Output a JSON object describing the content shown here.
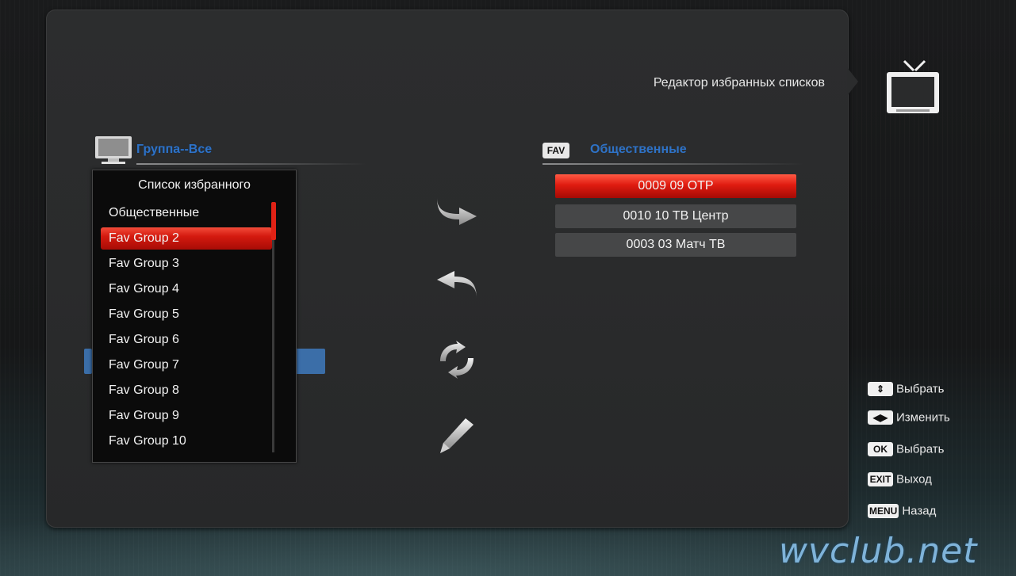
{
  "screen": {
    "title": "Редактор избранных списков"
  },
  "group": {
    "title": "Группа--Все"
  },
  "favorite_popup": {
    "header": "Список избранного",
    "items": [
      {
        "label": "Общественные"
      },
      {
        "label": "Fav Group 2",
        "selected": true
      },
      {
        "label": "Fav Group 3"
      },
      {
        "label": "Fav Group 4"
      },
      {
        "label": "Fav Group 5"
      },
      {
        "label": "Fav Group 6"
      },
      {
        "label": "Fav Group 7"
      },
      {
        "label": "Fav Group 8"
      },
      {
        "label": "Fav Group 9"
      },
      {
        "label": "Fav Group 10"
      }
    ]
  },
  "actions": [
    {
      "icon": "move-right-arrow-icon"
    },
    {
      "icon": "move-left-arrow-icon"
    },
    {
      "icon": "swap-circular-arrows-icon"
    },
    {
      "icon": "edit-pencil-icon"
    }
  ],
  "favorites": {
    "badge": "FAV",
    "title": "Общественные",
    "channels": [
      {
        "label": "0009 09 ОТР",
        "selected": true
      },
      {
        "label": "0010 10 ТВ Центр"
      },
      {
        "label": "0003 03 Матч ТВ"
      }
    ]
  },
  "hints": [
    {
      "key": "⇕",
      "label": "Выбрать"
    },
    {
      "key": "◀▶",
      "label": "Изменить"
    },
    {
      "key": "OK",
      "label": "Выбрать"
    },
    {
      "key": "EXIT",
      "label": "Выход"
    },
    {
      "key": "MENU",
      "label": "Назад"
    }
  ],
  "watermark": "wvclub.net",
  "colors": {
    "accent_red": "#e01b10",
    "accent_blue": "#2e72c6",
    "panel": "#2a2b2c"
  }
}
